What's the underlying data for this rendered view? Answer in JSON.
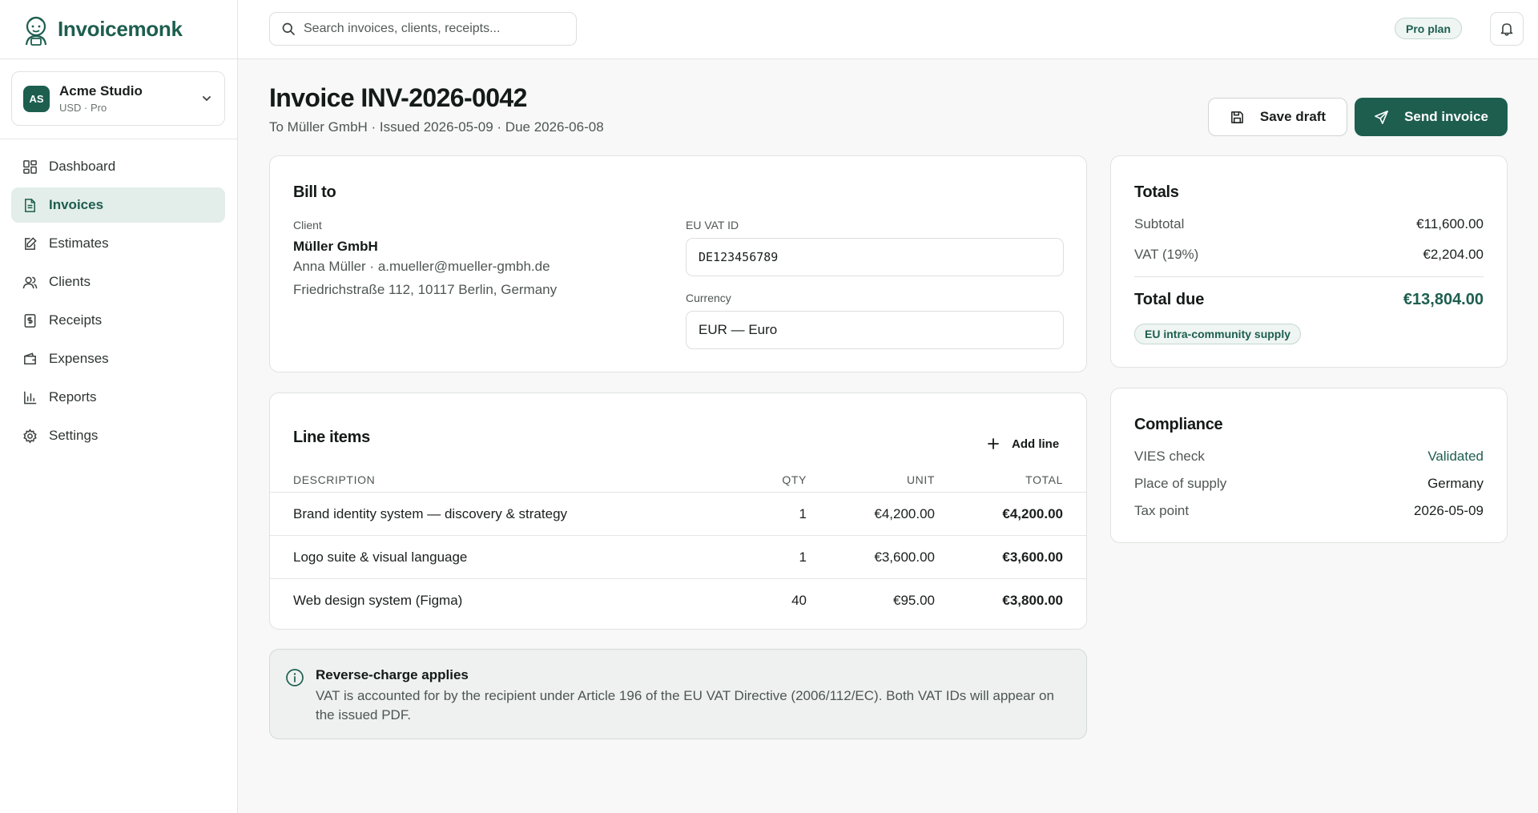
{
  "app": {
    "name": "Invoicemonk"
  },
  "workspace": {
    "initials": "AS",
    "name": "Acme Studio",
    "sub": "USD · Pro"
  },
  "nav": [
    {
      "label": "Dashboard",
      "icon": "dashboard-icon"
    },
    {
      "label": "Invoices",
      "icon": "invoice-icon",
      "active": true
    },
    {
      "label": "Estimates",
      "icon": "estimate-icon"
    },
    {
      "label": "Clients",
      "icon": "clients-icon"
    },
    {
      "label": "Receipts",
      "icon": "receipt-icon"
    },
    {
      "label": "Expenses",
      "icon": "wallet-icon"
    },
    {
      "label": "Reports",
      "icon": "bar-chart-icon"
    },
    {
      "label": "Settings",
      "icon": "gear-icon"
    }
  ],
  "search": {
    "placeholder": "Search invoices, clients, receipts..."
  },
  "header": {
    "plan_badge": "Pro plan"
  },
  "invoice": {
    "title": "Invoice INV-2026-0042",
    "subtitle": "To Müller GmbH · Issued 2026-05-09 · Due 2026-06-08",
    "save_label": "Save draft",
    "send_label": "Send invoice"
  },
  "bill_to": {
    "title": "Bill to",
    "client_label": "Client",
    "client_name": "Müller GmbH",
    "client_contact": "Anna Müller · a.mueller@mueller-gmbh.de",
    "client_address": "Friedrichstraße 112, 10117 Berlin, Germany",
    "vat_label": "EU VAT ID",
    "vat_value": "DE123456789",
    "currency_label": "Currency",
    "currency_value": "EUR — Euro"
  },
  "line_items": {
    "title": "Line items",
    "add_label": "Add line",
    "columns": {
      "description": "DESCRIPTION",
      "qty": "QTY",
      "unit": "UNIT",
      "total": "TOTAL"
    },
    "rows": [
      {
        "description": "Brand identity system — discovery & strategy",
        "qty": "1",
        "unit": "€4,200.00",
        "total": "€4,200.00"
      },
      {
        "description": "Logo suite & visual language",
        "qty": "1",
        "unit": "€3,600.00",
        "total": "€3,600.00"
      },
      {
        "description": "Web design system (Figma)",
        "qty": "40",
        "unit": "€95.00",
        "total": "€3,800.00"
      }
    ]
  },
  "notice": {
    "title": "Reverse-charge applies",
    "body": "VAT is accounted for by the recipient under Article 196 of the EU VAT Directive (2006/112/EC). Both VAT IDs will appear on the issued PDF."
  },
  "totals": {
    "title": "Totals",
    "subtotal_label": "Subtotal",
    "subtotal_value": "€11,600.00",
    "vat_label": "VAT (19%)",
    "vat_value": "€2,204.00",
    "total_label": "Total due",
    "total_value": "€13,804.00",
    "badge": "EU intra-community supply"
  },
  "compliance": {
    "title": "Compliance",
    "vies_label": "VIES check",
    "vies_value": "Validated",
    "place_label": "Place of supply",
    "place_value": "Germany",
    "taxpoint_label": "Tax point",
    "taxpoint_value": "2026-05-09"
  },
  "colors": {
    "brand": "#1d5e4f",
    "brand_soft": "#e3ede9",
    "background": "#f7f8f7"
  }
}
